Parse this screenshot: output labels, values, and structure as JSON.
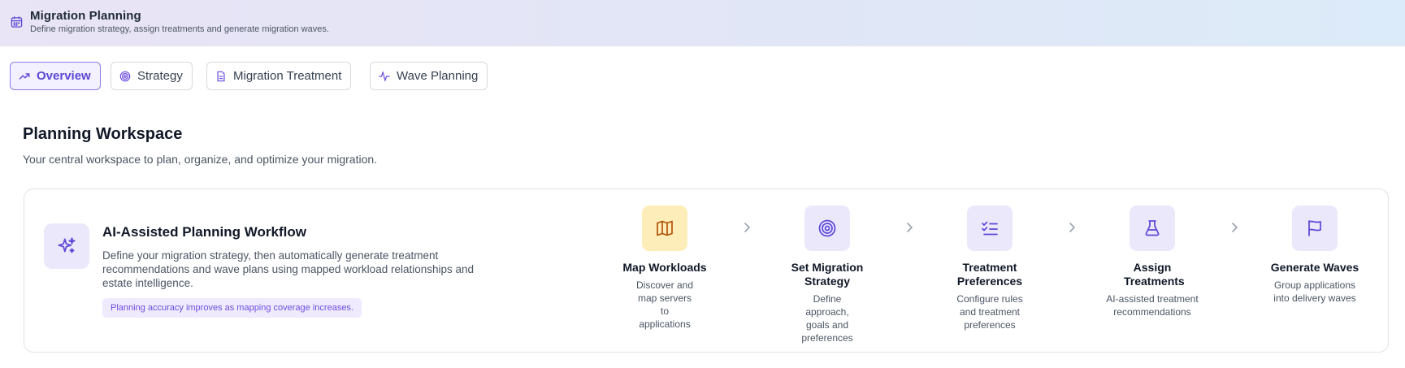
{
  "header": {
    "title": "Migration Planning",
    "subtitle": "Define migration strategy, assign treatments and generate migration waves.",
    "icon": "calendar-icon"
  },
  "tabs": [
    {
      "label": "Overview",
      "icon": "trending-up-icon",
      "active": true
    },
    {
      "label": "Strategy",
      "icon": "target-icon",
      "active": false
    },
    {
      "label": "Migration Treatment",
      "icon": "file-icon",
      "active": false
    },
    {
      "label": "Wave Planning",
      "icon": "activity-icon",
      "active": false
    }
  ],
  "workspace": {
    "title": "Planning Workspace",
    "description": "Your central workspace to plan, organize, and optimize your migration."
  },
  "workflow": {
    "title": "AI-Assisted Planning Workflow",
    "description": "Define your migration strategy, then automatically generate treatment recommendations and wave plans using mapped workload relationships and estate intelligence.",
    "note": "Planning accuracy improves as mapping coverage increases.",
    "steps": [
      {
        "title": "Map Workloads",
        "description": "Discover and map servers to applications",
        "icon": "map-icon"
      },
      {
        "title": "Set Migration Strategy",
        "description": "Define approach, goals and preferences",
        "icon": "target-icon"
      },
      {
        "title": "Treatment Preferences",
        "description": "Configure rules and treatment preferences",
        "icon": "list-checks-icon"
      },
      {
        "title": "Assign Treatments",
        "description": "AI-assisted treatment recommendations",
        "icon": "flask-icon"
      },
      {
        "title": "Generate Waves",
        "description": "Group applications into delivery waves",
        "icon": "flag-icon"
      }
    ]
  },
  "colors": {
    "accent": "#6d4fe0",
    "icon_bg": "#ece8fc",
    "amber_bg": "#fdedb9",
    "amber_icon": "#b45309"
  }
}
